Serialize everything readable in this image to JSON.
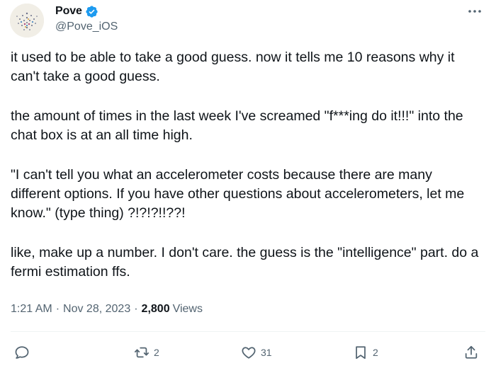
{
  "author": {
    "display_name": "Pove",
    "handle": "@Pove_iOS",
    "verified": true
  },
  "tweet": {
    "paragraphs": [
      "it used to be able to take a good guess. now it tells me 10 reasons why it can't take a good guess.",
      "the amount of times in the last week I've screamed \"f***ing do it!!!\" into the chat box is at an all time high.",
      "\"I can't tell you what an accelerometer costs because there are many different options. If you have other questions about accelerometers, let me know.\" (type thing) ?!?!?!!??!",
      "like, make up a number. I don't care. the guess is the \"intelligence\" part. do a fermi estimation ffs."
    ]
  },
  "meta": {
    "time": "1:21 AM",
    "separator": "·",
    "date": "Nov 28, 2023",
    "views_count": "2,800",
    "views_label": "Views"
  },
  "actions": {
    "reply_count": "",
    "retweet_count": "2",
    "like_count": "31",
    "bookmark_count": "2"
  },
  "icons": {
    "more": "more-icon",
    "verified": "verified-badge-icon",
    "reply": "reply-icon",
    "retweet": "retweet-icon",
    "like": "heart-icon",
    "bookmark": "bookmark-icon",
    "share": "share-icon"
  },
  "colors": {
    "text": "#0f1419",
    "secondary": "#536471",
    "verified": "#1d9bf0"
  }
}
